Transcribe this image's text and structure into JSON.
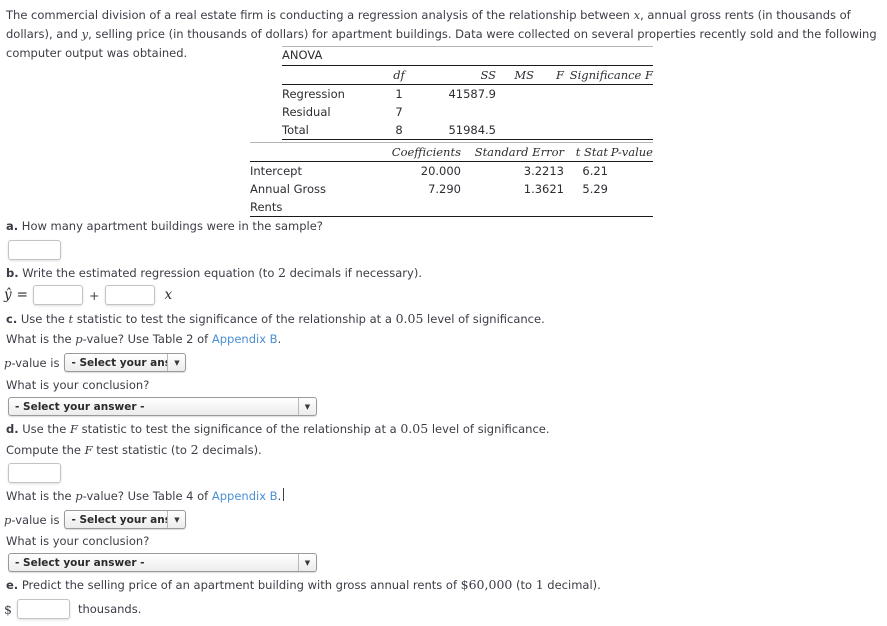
{
  "problem": {
    "intro_line1_a": "The commercial division of a real estate firm is conducting a regression analysis of the relationship between ",
    "intro_var_x": "x",
    "intro_line1_b": ", annual gross rents (in thousands of dollars), and ",
    "intro_var_y": "y",
    "intro_line1_c": ", selling price (in thousands of dollars) for apartment buildings. Data were collected on several properties recently sold and the following computer output was obtained."
  },
  "anova": {
    "title": "ANOVA",
    "headers": [
      "",
      "df",
      "SS",
      "MS",
      "F",
      "Significance F"
    ],
    "rows": [
      {
        "label": "Regression",
        "df": "1",
        "ss": "41587.9",
        "ms": "",
        "f": "",
        "sig": ""
      },
      {
        "label": "Residual",
        "df": "7",
        "ss": "",
        "ms": "",
        "f": "",
        "sig": ""
      },
      {
        "label": "Total",
        "df": "8",
        "ss": "51984.5",
        "ms": "",
        "f": "",
        "sig": ""
      }
    ]
  },
  "coefficients": {
    "headers": [
      "",
      "Coefficients",
      "Standard Error",
      "t Stat",
      "P-value"
    ],
    "rows": [
      {
        "label": "Intercept",
        "coef": "20.000",
        "se": "3.2213",
        "t": "6.21",
        "p": ""
      },
      {
        "label": "Annual Gross",
        "coef": "7.290",
        "se": "1.3621",
        "t": "5.29",
        "p": ""
      },
      {
        "label": "Rents",
        "coef": "",
        "se": "",
        "t": "",
        "p": ""
      }
    ]
  },
  "questions": {
    "a": {
      "marker": "a.",
      "text": "How many apartment buildings were in the sample?",
      "answer_value": "",
      "answer_placeholder": ""
    },
    "b": {
      "marker": "b.",
      "text_before": "Write the estimated regression equation (to ",
      "decimals": "2",
      "text_after": " decimals if necessary).",
      "eq_yhat": "ŷ",
      "eq_equals": "=",
      "eq_plus": "+",
      "eq_x": "x",
      "intercept_value": "",
      "slope_value": ""
    },
    "c": {
      "marker": "c.",
      "text_before": "Use the ",
      "stat_symbol": "t",
      "text_mid": " statistic to test the significance of the relationship at a ",
      "alpha": "0.05",
      "text_after": " level of significance.",
      "pvalue_question_before": "What is the ",
      "pvalue_question_p": "p",
      "pvalue_question_after": "-value? Use Table 2 of ",
      "appendix_link": "Appendix B",
      "appendix_period": ".",
      "pvalue_prefix_p": "p",
      "pvalue_prefix_rest": "-value is",
      "pvalue_select": "- Select your answer -",
      "conclusion_question": "What is your conclusion?",
      "conclusion_select": "- Select your answer -"
    },
    "d": {
      "marker": "d.",
      "text_before": "Use the ",
      "stat_symbol": "F",
      "text_mid": " statistic to test the significance of the relationship at a ",
      "alpha": "0.05",
      "text_after": " level of significance.",
      "compute_before": "Compute the ",
      "compute_symbol": "F",
      "compute_mid": " test statistic (to ",
      "compute_decimals": "2",
      "compute_after": " decimals).",
      "fstat_value": "",
      "pvalue_question_before": "What is the ",
      "pvalue_question_p": "p",
      "pvalue_question_after": "-value? Use Table 4 of ",
      "appendix_link": "Appendix B",
      "appendix_period": ".",
      "pvalue_prefix_p": "p",
      "pvalue_prefix_rest": "-value is",
      "pvalue_select": "- Select your answer -",
      "conclusion_question": "What is your conclusion?",
      "conclusion_select": "- Select your answer -"
    },
    "e": {
      "marker": "e.",
      "text_before": "Predict the selling price of an apartment building with gross annual rents of ",
      "amount": "$60,000",
      "text_mid": " (to ",
      "decimals": "1",
      "text_after": " decimal).",
      "dollar_sign": "$",
      "answer_value": "",
      "units": "thousands."
    }
  },
  "icons": {
    "caret_down": "▼"
  },
  "colors": {
    "text": "#3c3c46",
    "link": "#4a8fd4",
    "rule": "#1a1a1a"
  }
}
